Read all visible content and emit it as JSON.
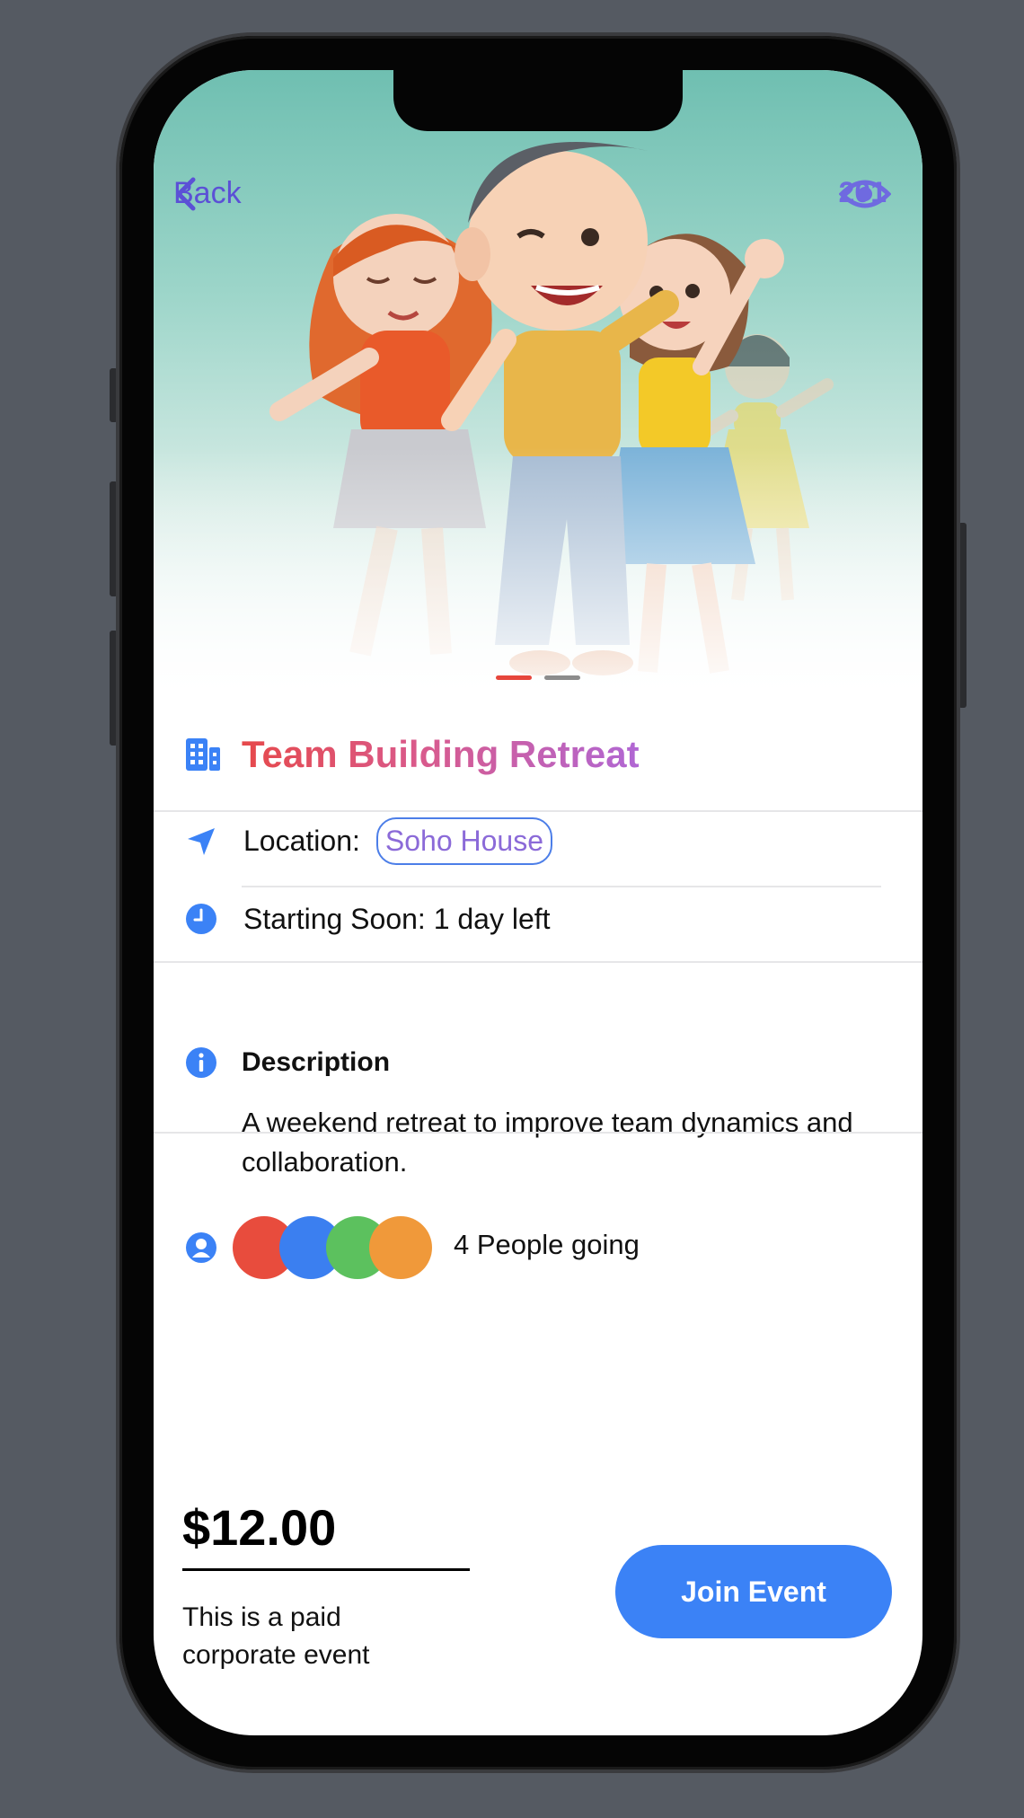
{
  "nav": {
    "back_label": "Back",
    "view_count": "201"
  },
  "carousel": {
    "active_index": 0,
    "total": 2,
    "active_color": "#e6463c",
    "inactive_color": "#8c8c8c"
  },
  "event": {
    "title": "Team Building Retreat",
    "location_label": "Location:",
    "location_value": "Soho House",
    "status_text": "Starting Soon: 1 day left",
    "description_title": "Description",
    "description_body": "A weekend retreat to improve team dynamics and collaboration.",
    "attendee_colors": [
      "#e84c3d",
      "#3b7ff0",
      "#5cc15e",
      "#f0993a"
    ],
    "going_text": "4 People going"
  },
  "footer": {
    "price": "$12.00",
    "price_note": "This is a paid corporate event",
    "join_label": "Join Event"
  },
  "colors": {
    "accent_blue": "#3b82f6",
    "back_purple": "#5b50d6",
    "title_gradient": [
      "#e6494b",
      "#b067d4"
    ]
  }
}
